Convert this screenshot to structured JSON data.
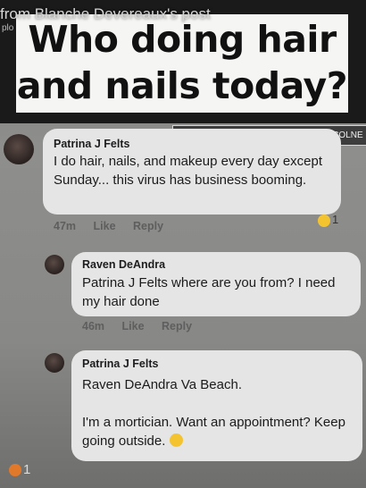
{
  "overlay": {
    "caption": "from Blanche Devereaux's post",
    "caption_sub": "plo",
    "headline_line1": "Who doing hair",
    "headline_line2": "and nails today?",
    "location_tag": "● BETTY-ROSE BEAUTY BOUTIQUE COLNE"
  },
  "comments": [
    {
      "author": "Patrina J Felts",
      "text": "I do hair, nails, and makeup every day except Sunday... this virus has business booming.",
      "time": "47m",
      "like": "Like",
      "reply": "Reply",
      "reaction_count": "1"
    },
    {
      "author": "Raven DeAndra",
      "text": "Patrina J Felts where are you from? I need my hair done",
      "time": "46m",
      "like": "Like",
      "reply": "Reply"
    },
    {
      "author": "Patrina J Felts",
      "mention": "Raven DeAndra Va Beach.",
      "text": "I'm a mortician. Want an appointment? Keep going outside.",
      "emoji_icon": "laughing-emoji-icon"
    }
  ],
  "footer": {
    "reaction_count": "1"
  },
  "colors": {
    "bubble": "#e4e5e4",
    "headline_bg": "#f5f5f3",
    "header_bg": "#1a1a1a"
  }
}
